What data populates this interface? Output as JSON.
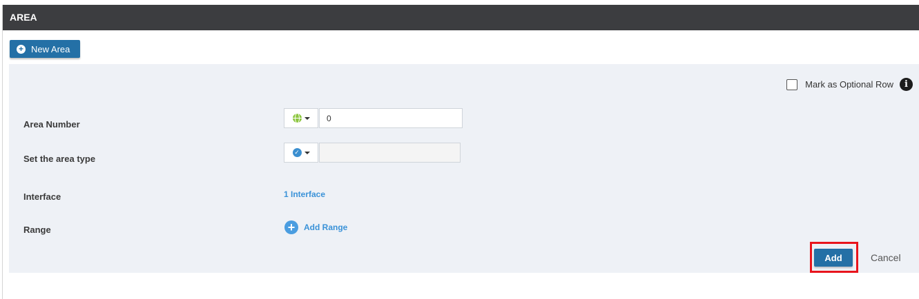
{
  "header": {
    "title": "AREA"
  },
  "toolbar": {
    "new_area_label": "New Area"
  },
  "form": {
    "optional_row_label": "Mark as Optional Row",
    "area_number": {
      "label": "Area Number",
      "value": "0"
    },
    "area_type": {
      "label": "Set the area type",
      "value": ""
    },
    "interface": {
      "label": "Interface",
      "link_text": "1 Interface"
    },
    "range": {
      "label": "Range",
      "add_text": "Add Range"
    }
  },
  "actions": {
    "add_label": "Add",
    "cancel_label": "Cancel"
  },
  "colors": {
    "header_bg": "#3c3d40",
    "primary_button": "#2470a6",
    "panel_bg": "#eef1f6",
    "link": "#3a92d8",
    "highlight": "#e8141c"
  },
  "icons": {
    "new_area": "plus-circle-icon",
    "info": "info-icon",
    "area_number_prefix": "globe-icon",
    "area_type_prefix": "check-circle-icon",
    "range_add": "plus-circle-icon"
  }
}
